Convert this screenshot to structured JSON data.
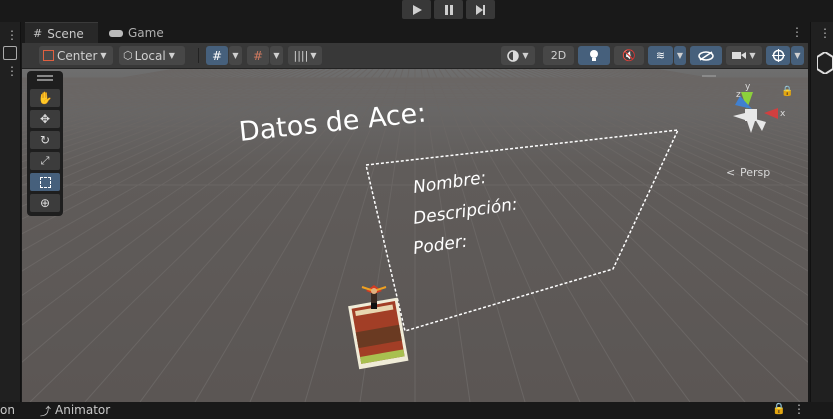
{
  "playbar": {
    "play": "play-icon",
    "pause": "pause-icon",
    "step": "step-icon"
  },
  "tabs": [
    {
      "label": "Scene"
    },
    {
      "label": "Game"
    }
  ],
  "toolbar": {
    "pivot_label": "Center",
    "space_label": "Local",
    "twod_label": "2D"
  },
  "scene": {
    "title_text": "Datos de Ace:",
    "line1": "Nombre:",
    "line2": "Descripción:",
    "line3": "Poder:",
    "persp_label": "Persp",
    "gizmo_y": "y",
    "gizmo_x": "x",
    "gizmo_z": "z"
  },
  "bottom": {
    "left_text": "on",
    "animator_label": "Animator"
  },
  "colors": {
    "grid_bg": "#5d5d5d",
    "accent_blue": "#46607c",
    "panel_dark": "#383838"
  }
}
